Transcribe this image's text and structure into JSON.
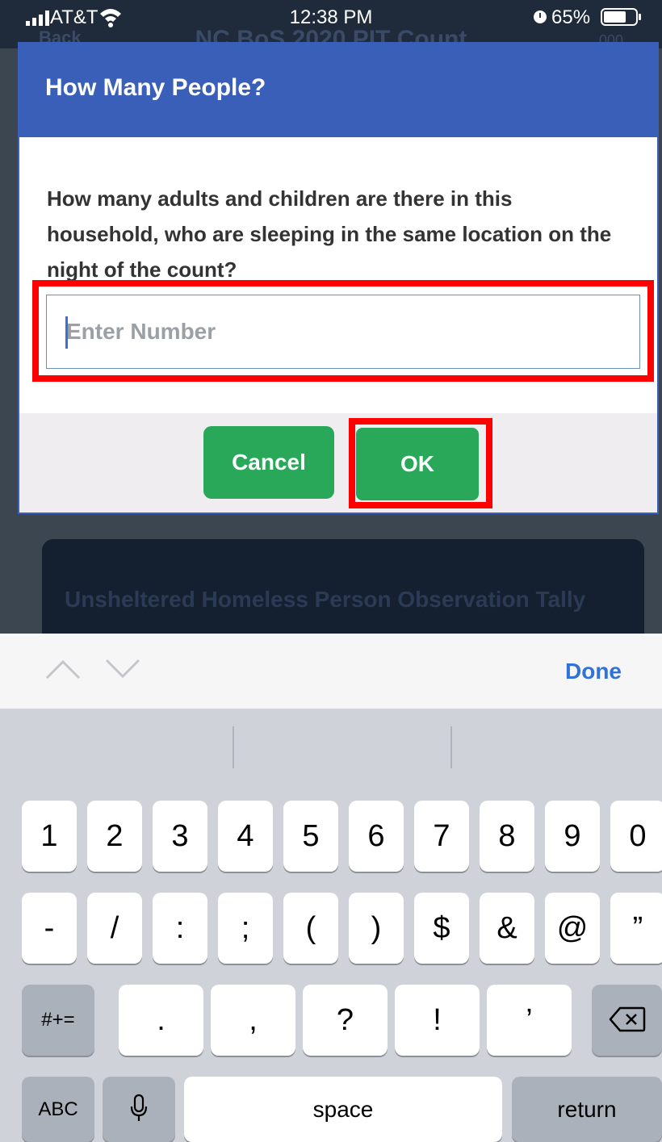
{
  "status_bar": {
    "carrier": "AT&T",
    "time": "12:38 PM",
    "battery": "65%"
  },
  "background": {
    "header_left": "Back",
    "header_title": "NC BoS 2020 PIT Count",
    "header_right": "000",
    "card_title": "Unsheltered Homeless Person Observation Tally"
  },
  "dialog": {
    "title": "How Many People?",
    "question": "How many adults and children are there in this household, who are sleeping in the same location on the night of the count?",
    "input_placeholder": "Enter Number",
    "cancel_label": "Cancel",
    "ok_label": "OK"
  },
  "keyboard_toolbar": {
    "done_label": "Done"
  },
  "keyboard": {
    "row1": [
      "1",
      "2",
      "3",
      "4",
      "5",
      "6",
      "7",
      "8",
      "9",
      "0"
    ],
    "row2": [
      "-",
      "/",
      ":",
      ";",
      "(",
      ")",
      "$",
      "&",
      "@",
      "”"
    ],
    "row3": {
      "shift_label": "#+=",
      "keys": [
        ".",
        ",",
        "?",
        "!",
        "’"
      ]
    },
    "row4": {
      "abc_label": "ABC",
      "space_label": "space",
      "return_label": "return"
    }
  },
  "colors": {
    "dialog_header": "#3a5fb8",
    "button_green": "#29a85a",
    "highlight": "#ff0000",
    "link_blue": "#2f73d8"
  }
}
